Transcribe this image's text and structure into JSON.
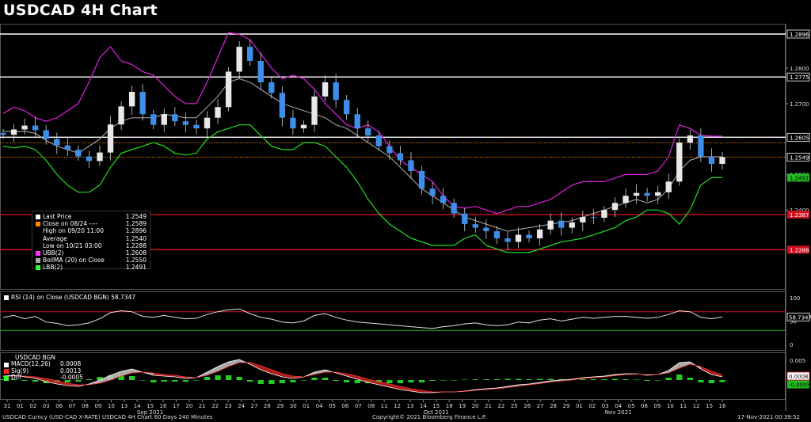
{
  "title": "USDCAD 4H Chart",
  "chart_data": {
    "type": "candlestick",
    "price_axis": {
      "ylim": [
        1.2175,
        1.2925
      ],
      "ticks": [
        {
          "value": 1.2896,
          "label": "1.2896",
          "style": "white-box"
        },
        {
          "value": 1.28,
          "label": "1.2800",
          "style": "plain"
        },
        {
          "value": 1.2775,
          "label": "1.2775",
          "style": "white-box"
        },
        {
          "value": 1.27,
          "label": "1.2700",
          "style": "plain"
        },
        {
          "value": 1.2605,
          "label": "1.2605",
          "style": "white-box"
        },
        {
          "value": 1.2549,
          "label": "1.2549",
          "style": "white-box"
        },
        {
          "value": 1.25,
          "label": "1.2500",
          "style": "plain"
        },
        {
          "value": 1.2491,
          "label": "1.2491",
          "style": "green-box"
        },
        {
          "value": 1.24,
          "label": "1.2400",
          "style": "plain"
        },
        {
          "value": 1.2387,
          "label": "1.2387",
          "style": "red-box"
        },
        {
          "value": 1.2288,
          "label": "1.2288",
          "style": "red-box"
        }
      ]
    },
    "horizontal_levels": [
      {
        "value": 1.2896,
        "color": "#ffffff"
      },
      {
        "value": 1.2775,
        "color": "#ffffff"
      },
      {
        "value": 1.2605,
        "color": "#ffffff"
      },
      {
        "value": 1.2387,
        "color": "#d01020"
      },
      {
        "value": 1.2288,
        "color": "#d01020"
      }
    ],
    "dotted_levels": [
      {
        "value": 1.2589,
        "color": "#ff8c00"
      },
      {
        "value": 1.2549,
        "color": "#ff8c00"
      }
    ],
    "date_axis": {
      "ticks": [
        "31",
        "01",
        "02",
        "03",
        "06",
        "07",
        "08",
        "09",
        "10",
        "13",
        "14",
        "15",
        "16",
        "17",
        "20",
        "21",
        "22",
        "23",
        "24",
        "27",
        "28",
        "29",
        "30",
        "01",
        "04",
        "05",
        "06",
        "07",
        "08",
        "11",
        "12",
        "13",
        "14",
        "15",
        "18",
        "19",
        "20",
        "21",
        "22",
        "25",
        "26",
        "27",
        "28",
        "29",
        "01",
        "02",
        "03",
        "04",
        "05",
        "08",
        "09",
        "10",
        "11",
        "12",
        "15",
        "16"
      ],
      "months": [
        {
          "label": "Sep 2021",
          "at_tick": 11
        },
        {
          "label": "Oct 2021",
          "at_tick": 33
        },
        {
          "label": "Nov 2021",
          "at_tick": 47
        }
      ]
    },
    "close_series": [
      1.2612,
      1.2627,
      1.2638,
      1.2625,
      1.26,
      1.2582,
      1.257,
      1.2551,
      1.2538,
      1.2562,
      1.2641,
      1.2692,
      1.2733,
      1.267,
      1.264,
      1.267,
      1.265,
      1.264,
      1.263,
      1.266,
      1.269,
      1.279,
      1.286,
      1.282,
      1.276,
      1.273,
      1.266,
      1.263,
      1.264,
      1.272,
      1.276,
      1.271,
      1.267,
      1.263,
      1.261,
      1.258,
      1.256,
      1.254,
      1.251,
      1.246,
      1.244,
      1.242,
      1.239,
      1.236,
      1.235,
      1.234,
      1.232,
      1.231,
      1.233,
      1.232,
      1.2345,
      1.237,
      1.235,
      1.2365,
      1.238,
      1.2378,
      1.24,
      1.242,
      1.244,
      1.2448,
      1.244,
      1.245,
      1.248,
      1.259,
      1.261,
      1.255,
      1.253,
      1.2549
    ],
    "upper_band": [
      1.2672,
      1.269,
      1.268,
      1.266,
      1.265,
      1.266,
      1.268,
      1.27,
      1.276,
      1.283,
      1.286,
      1.282,
      1.281,
      1.279,
      1.278,
      1.275,
      1.272,
      1.27,
      1.27,
      1.276,
      1.283,
      1.29,
      1.2895,
      1.288,
      1.284,
      1.28,
      1.277,
      1.278,
      1.277,
      1.274,
      1.27,
      1.267,
      1.264,
      1.263,
      1.264,
      1.262,
      1.258,
      1.254,
      1.252,
      1.25,
      1.248,
      1.244,
      1.241,
      1.2405,
      1.241,
      1.24,
      1.239,
      1.24,
      1.241,
      1.241,
      1.242,
      1.243,
      1.245,
      1.247,
      1.248,
      1.248,
      1.248,
      1.249,
      1.25,
      1.25,
      1.25,
      1.251,
      1.255,
      1.264,
      1.263,
      1.261,
      1.2608,
      1.2608
    ],
    "middle_band": [
      1.2622,
      1.262,
      1.2622,
      1.2616,
      1.2596,
      1.258,
      1.257,
      1.256,
      1.258,
      1.26,
      1.263,
      1.265,
      1.266,
      1.266,
      1.266,
      1.267,
      1.2665,
      1.266,
      1.266,
      1.269,
      1.272,
      1.276,
      1.277,
      1.276,
      1.274,
      1.272,
      1.27,
      1.269,
      1.268,
      1.267,
      1.266,
      1.264,
      1.263,
      1.261,
      1.259,
      1.257,
      1.255,
      1.252,
      1.249,
      1.246,
      1.244,
      1.242,
      1.24,
      1.238,
      1.237,
      1.236,
      1.235,
      1.234,
      1.2345,
      1.235,
      1.2355,
      1.236,
      1.2365,
      1.237,
      1.238,
      1.239,
      1.24,
      1.241,
      1.242,
      1.243,
      1.242,
      1.243,
      1.246,
      1.251,
      1.254,
      1.255,
      1.255,
      1.255
    ],
    "lower_band": [
      1.258,
      1.2575,
      1.258,
      1.257,
      1.254,
      1.25,
      1.247,
      1.245,
      1.245,
      1.247,
      1.252,
      1.256,
      1.257,
      1.258,
      1.259,
      1.258,
      1.256,
      1.2555,
      1.256,
      1.26,
      1.262,
      1.263,
      1.264,
      1.264,
      1.261,
      1.258,
      1.257,
      1.257,
      1.259,
      1.259,
      1.258,
      1.255,
      1.252,
      1.248,
      1.243,
      1.239,
      1.236,
      1.234,
      1.232,
      1.231,
      1.23,
      1.23,
      1.23,
      1.232,
      1.233,
      1.23,
      1.229,
      1.228,
      1.228,
      1.228,
      1.229,
      1.23,
      1.231,
      1.2315,
      1.232,
      1.233,
      1.234,
      1.235,
      1.237,
      1.238,
      1.24,
      1.24,
      1.239,
      1.236,
      1.24,
      1.247,
      1.2491,
      1.2491
    ],
    "legend": [
      {
        "color": "#ffffff",
        "label": "Last Price",
        "value": "1.2549"
      },
      {
        "color": "#ff8c00",
        "label": "Close on 08/24 ----",
        "value": "1.2589"
      },
      {
        "color": "",
        "label": "High on 09/20 11:00",
        "value": "1.2896"
      },
      {
        "color": "",
        "label": "Average",
        "value": "1.2540"
      },
      {
        "color": "",
        "label": "Low on 10/21 03:00",
        "value": "1.2288"
      },
      {
        "color": "#ff33ff",
        "label": "UBB(2)",
        "value": "1.2608"
      },
      {
        "color": "#aaaaaa",
        "label": "BollMA (20)  on Close",
        "value": "1.2550"
      },
      {
        "color": "#33ff33",
        "label": "LBB(2)",
        "value": "1.2491"
      }
    ],
    "rsi": {
      "label": "RSI (14)  on Close (USDCAD BGN) 58.7347",
      "current": "58.7347",
      "ylim": [
        0,
        100
      ],
      "ticks": [
        "100",
        "50",
        "0"
      ],
      "levels": [
        70,
        30
      ],
      "values": [
        58,
        62,
        55,
        60,
        48,
        45,
        40,
        42,
        46,
        55,
        68,
        72,
        70,
        60,
        58,
        62,
        58,
        55,
        56,
        64,
        70,
        74,
        76,
        66,
        58,
        54,
        48,
        46,
        50,
        62,
        66,
        58,
        52,
        48,
        46,
        44,
        42,
        40,
        38,
        36,
        34,
        38,
        40,
        44,
        46,
        42,
        40,
        42,
        48,
        46,
        52,
        55,
        50,
        54,
        58,
        56,
        58,
        60,
        60,
        58,
        56,
        58,
        64,
        72,
        70,
        58,
        55,
        59
      ]
    },
    "macd": {
      "label": "USDCAD BGN",
      "legend": [
        {
          "color": "#ffffff",
          "label": "MACD(12,26)",
          "value": "0.0008"
        },
        {
          "color": "#ff2222",
          "label": "Sig(9)",
          "value": "0.0013"
        },
        {
          "color": "#33ff33",
          "label": "Diff",
          "value": "-0.0005"
        }
      ],
      "ylim": [
        -0.004,
        0.006
      ],
      "ticks": [
        "0.005",
        "0.0008",
        "-0.0005"
      ],
      "values": [
        0.001,
        0.0012,
        0.0008,
        0.0004,
        -0.0004,
        -0.001,
        -0.0014,
        -0.0016,
        -0.001,
        0.0,
        0.0012,
        0.0022,
        0.0028,
        0.002,
        0.0012,
        0.001,
        0.0008,
        0.0004,
        0.0006,
        0.002,
        0.0034,
        0.0046,
        0.0052,
        0.004,
        0.0026,
        0.0016,
        0.0008,
        0.0004,
        0.0008,
        0.002,
        0.0026,
        0.0018,
        0.001,
        0.0002,
        -0.0006,
        -0.0012,
        -0.0018,
        -0.0024,
        -0.0028,
        -0.0032,
        -0.0032,
        -0.003,
        -0.003,
        -0.0028,
        -0.0024,
        -0.0022,
        -0.002,
        -0.0016,
        -0.0012,
        -0.001,
        -0.0006,
        -0.0002,
        0.0,
        0.0002,
        0.0006,
        0.0008,
        0.001,
        0.0014,
        0.0016,
        0.0016,
        0.0012,
        0.0014,
        0.0024,
        0.0044,
        0.0046,
        0.0028,
        0.0014,
        0.0008
      ],
      "signal": [
        0.0008,
        0.001,
        0.001,
        0.0008,
        0.0004,
        -0.0002,
        -0.0008,
        -0.0012,
        -0.0012,
        -0.0008,
        0.0,
        0.001,
        0.0018,
        0.002,
        0.0018,
        0.0014,
        0.0012,
        0.0008,
        0.0006,
        0.0012,
        0.0022,
        0.0034,
        0.0044,
        0.0044,
        0.0036,
        0.0026,
        0.0016,
        0.001,
        0.0008,
        0.0014,
        0.002,
        0.002,
        0.0016,
        0.001,
        0.0002,
        -0.0004,
        -0.001,
        -0.0016,
        -0.0022,
        -0.0026,
        -0.003,
        -0.003,
        -0.003,
        -0.0029,
        -0.0026,
        -0.0024,
        -0.0022,
        -0.0019,
        -0.0015,
        -0.0012,
        -0.0009,
        -0.0005,
        -0.0002,
        0.0,
        0.0004,
        0.0006,
        0.0008,
        0.0011,
        0.0014,
        0.0015,
        0.0014,
        0.0014,
        0.0018,
        0.003,
        0.004,
        0.0034,
        0.0022,
        0.0013
      ]
    }
  },
  "footer": {
    "left": "USDCAD Curncy (USD-CAD X-RATE) USDCAD 4H Chart 60 Days 240 Minutes",
    "middle": "Copyright© 2021 Bloomberg Finance L.P.",
    "right": "17-Nov-2021 00:39:52"
  }
}
